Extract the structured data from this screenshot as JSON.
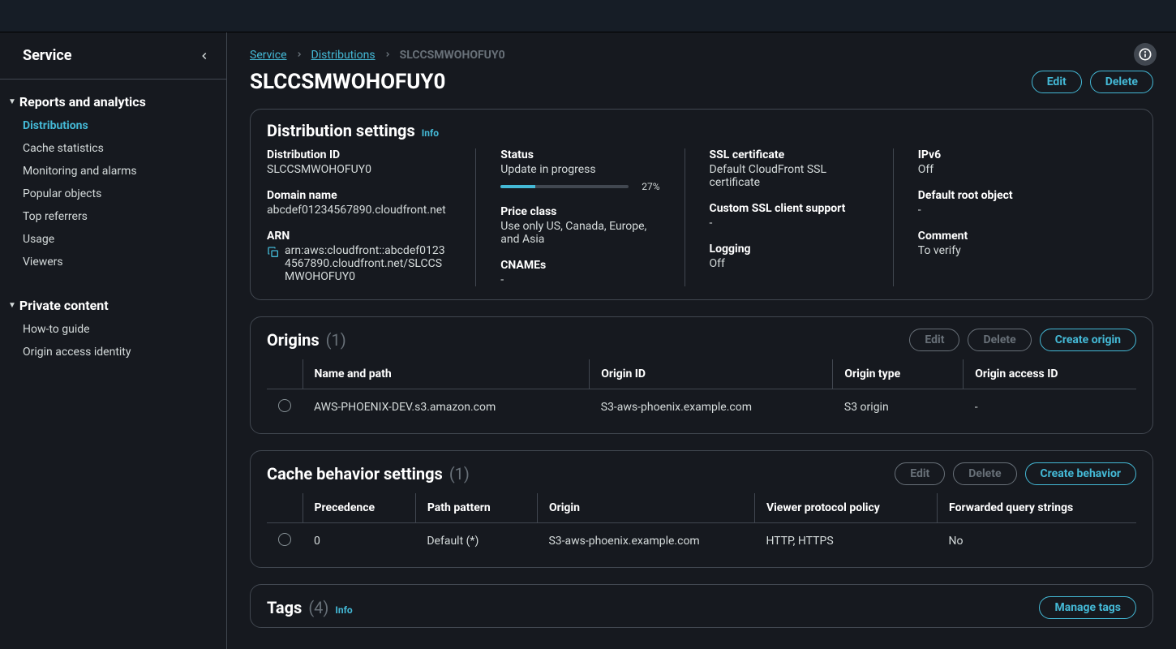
{
  "sidebar": {
    "title": "Service",
    "sections": [
      {
        "title": "Reports and analytics",
        "items": [
          "Distributions",
          "Cache statistics",
          "Monitoring and alarms",
          "Popular objects",
          "Top referrers",
          "Usage",
          "Viewers"
        ]
      },
      {
        "title": "Private content",
        "items": [
          "How-to guide",
          "Origin access identity"
        ]
      }
    ]
  },
  "breadcrumb": {
    "items": [
      "Service",
      "Distributions",
      "SLCCSMWOHOFUY0"
    ]
  },
  "page": {
    "title": "SLCCSMWOHOFUY0",
    "edit": "Edit",
    "delete": "Delete"
  },
  "settings": {
    "title": "Distribution settings",
    "info": "Info",
    "dist_id_label": "Distribution ID",
    "dist_id": "SLCCSMWOHOFUY0",
    "domain_label": "Domain name",
    "domain": "abcdef01234567890.cloudfront.net",
    "arn_label": "ARN",
    "arn": "arn:aws:cloudfront::abcdef01234567890.cloudfront.net/SLCCSMWOHOFUY0",
    "status_label": "Status",
    "status": "Update in progress",
    "pct": "27%",
    "price_label": "Price class",
    "price": "Use only US, Canada, Europe, and Asia",
    "cnames_label": "CNAMEs",
    "cnames": "-",
    "ssl_label": "SSL certificate",
    "ssl": "Default CloudFront SSL certificate",
    "custom_ssl_label": "Custom SSL client support",
    "custom_ssl": "-",
    "logging_label": "Logging",
    "logging": "Off",
    "ipv6_label": "IPv6",
    "ipv6": "Off",
    "root_label": "Default root object",
    "root": "-",
    "comment_label": "Comment",
    "comment": "To verify"
  },
  "origins": {
    "title": "Origins",
    "count": "(1)",
    "edit": "Edit",
    "delete": "Delete",
    "create": "Create origin",
    "headers": [
      "Name and path",
      "Origin ID",
      "Origin type",
      "Origin access ID"
    ],
    "rows": [
      {
        "name": "AWS-PHOENIX-DEV.s3.amazon.com",
        "id": "S3-aws-phoenix.example.com",
        "type": "S3 origin",
        "access": "-"
      }
    ]
  },
  "cache": {
    "title": "Cache behavior settings",
    "count": "(1)",
    "edit": "Edit",
    "delete": "Delete",
    "create": "Create behavior",
    "headers": [
      "Precedence",
      "Path pattern",
      "Origin",
      "Viewer protocol policy",
      "Forwarded query strings"
    ],
    "rows": [
      {
        "precedence": "0",
        "pattern": "Default (*)",
        "origin": "S3-aws-phoenix.example.com",
        "policy": "HTTP, HTTPS",
        "fwd": "No"
      }
    ]
  },
  "tags": {
    "title": "Tags",
    "count": "(4)",
    "info": "Info",
    "manage": "Manage tags"
  }
}
